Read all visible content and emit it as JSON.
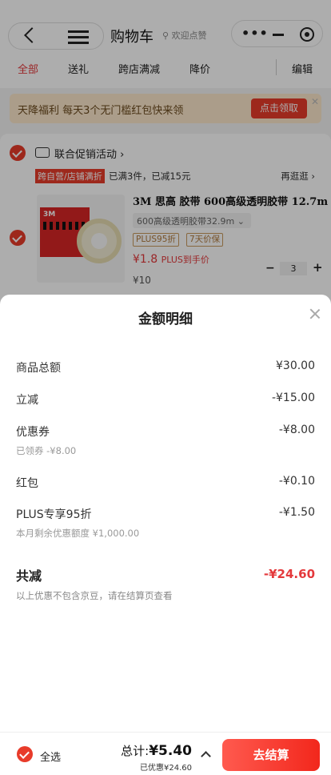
{
  "header": {
    "title": "购物车",
    "tagline": "欢迎点赞"
  },
  "tabs": [
    {
      "label": "全部"
    },
    {
      "label": "送礼"
    },
    {
      "label": "跨店满减"
    },
    {
      "label": "降价"
    },
    {
      "label": "编辑"
    }
  ],
  "banner": {
    "text": "天降福利 每天3个无门槛红包快来领",
    "button": "点击领取"
  },
  "promo": {
    "title": "联合促销活动",
    "tag": "跨自营/店铺满折",
    "note": "已满3件，已减15元",
    "more": "再逛逛 ›"
  },
  "product": {
    "brand": "3M",
    "title": "3M 思高 胶带 600高级透明胶带 12.7m",
    "spec": "600高级透明胶带32.9m",
    "tags": [
      "PLUS95折",
      "7天价保"
    ],
    "price": "¥1.8",
    "price_note": "PLUS到手价",
    "original_price": "¥10",
    "quantity": "3"
  },
  "sheet": {
    "title": "金额明细",
    "rows": [
      {
        "label": "商品总额",
        "value": "¥30.00",
        "sub": ""
      },
      {
        "label": "立减",
        "value": "-¥15.00",
        "sub": ""
      },
      {
        "label": "优惠券",
        "value": "-¥8.00",
        "sub": "已领券 -¥8.00"
      },
      {
        "label": "红包",
        "value": "-¥0.10",
        "sub": ""
      },
      {
        "label": "PLUS专享95折",
        "value": "-¥1.50",
        "sub": "本月剩余优惠额度 ¥1,000.00"
      }
    ],
    "total_label": "共减",
    "total_value": "-¥24.60",
    "total_note": "以上优惠不包含京豆，请在结算页查看"
  },
  "footer": {
    "select_all": "全选",
    "total_prefix": "总计:",
    "total_value": "¥5.40",
    "saved": "已优惠¥24.60",
    "checkout": "去结算"
  },
  "colors": {
    "accent": "#e4393c",
    "checkout_gradient": [
      "#ff5a4f",
      "#f2271c"
    ]
  }
}
